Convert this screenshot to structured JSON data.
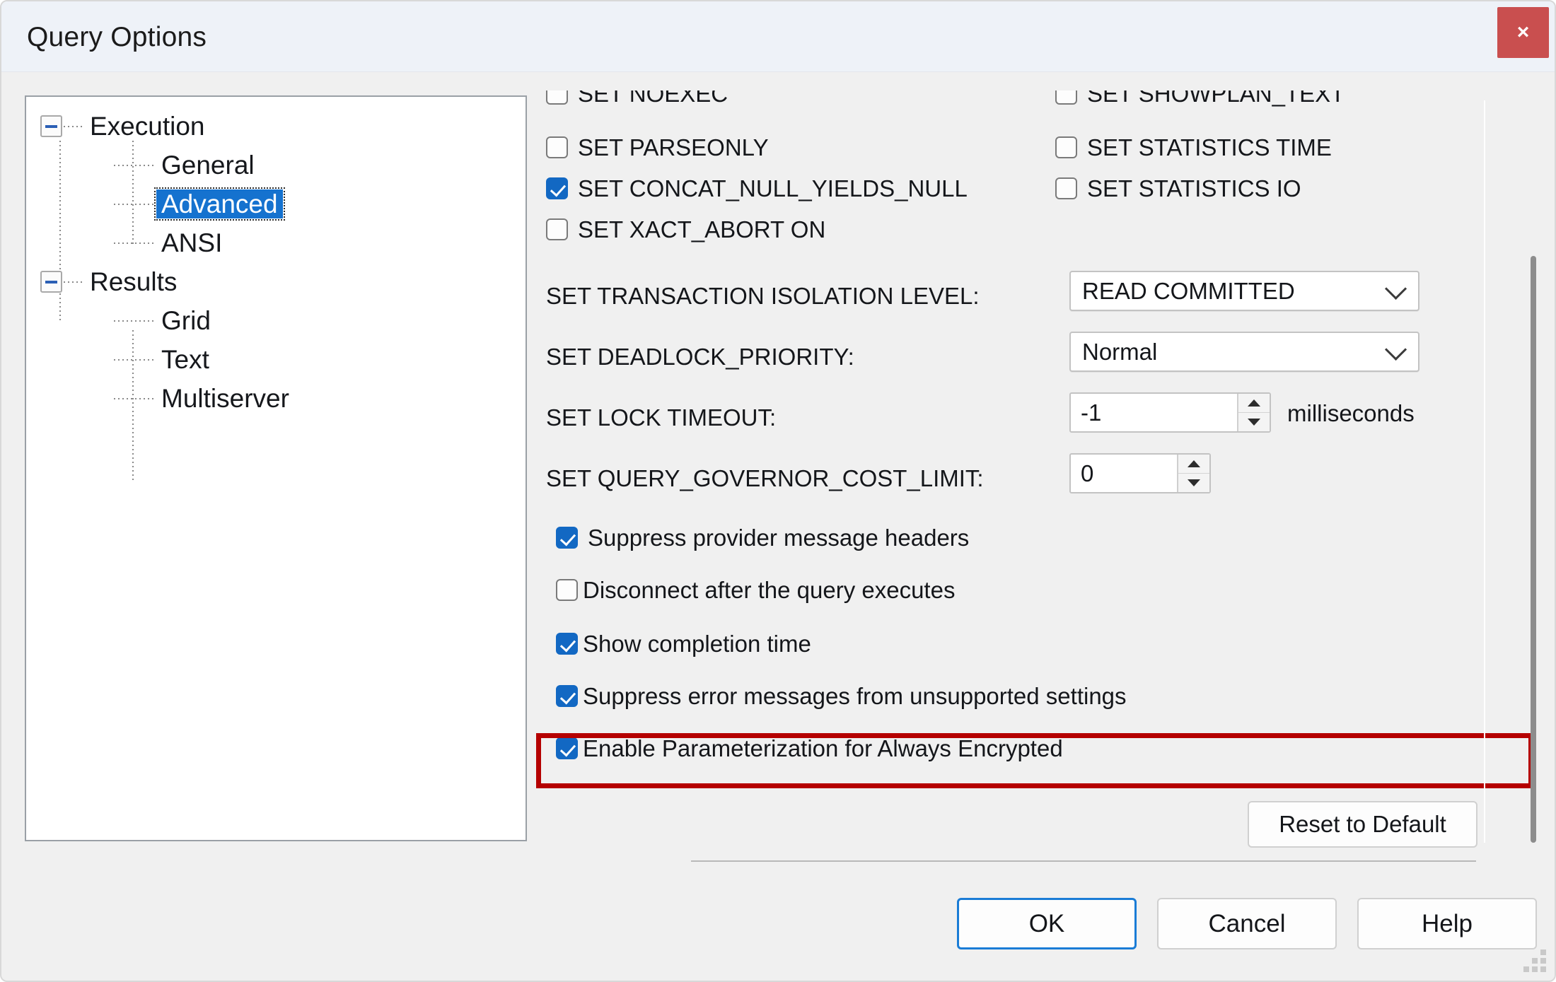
{
  "window": {
    "title": "Query Options",
    "close_label": "×"
  },
  "tree": {
    "nodes": [
      {
        "label": "Execution",
        "level": 0,
        "expander": "minus",
        "selected": false
      },
      {
        "label": "General",
        "level": 1,
        "expander": "none",
        "selected": false
      },
      {
        "label": "Advanced",
        "level": 1,
        "expander": "none",
        "selected": true
      },
      {
        "label": "ANSI",
        "level": 1,
        "expander": "none",
        "selected": false
      },
      {
        "label": "Results",
        "level": 0,
        "expander": "minus",
        "selected": false
      },
      {
        "label": "Grid",
        "level": 1,
        "expander": "none",
        "selected": false
      },
      {
        "label": "Text",
        "level": 1,
        "expander": "none",
        "selected": false
      },
      {
        "label": "Multiserver",
        "level": 1,
        "expander": "none",
        "selected": false
      }
    ]
  },
  "options": {
    "clipped_left": "SET NOEXEC",
    "clipped_right": "SET SHOWPLAN_TEXT",
    "checkbox_left": [
      {
        "label": "SET PARSEONLY",
        "checked": false,
        "mnemonic": "P"
      },
      {
        "label": "SET CONCAT_NULL_YIELDS_NULL",
        "checked": true,
        "mnemonic": "C"
      },
      {
        "label": "SET XACT_ABORT ON",
        "checked": false,
        "mnemonic": "X"
      }
    ],
    "checkbox_right": [
      {
        "label": "SET STATISTICS TIME",
        "checked": false,
        "mnemonic": "E"
      },
      {
        "label": "SET STATISTICS IO",
        "checked": false,
        "mnemonic": "A"
      }
    ],
    "isolation_level": {
      "label": "SET TRANSACTION ISOLATION LEVEL:",
      "value": "READ COMMITTED",
      "mnemonic": "T"
    },
    "deadlock_priority": {
      "label": "SET DEADLOCK_PRIORITY:",
      "value": "Normal",
      "mnemonic": "D"
    },
    "lock_timeout": {
      "label": "SET LOCK TIMEOUT:",
      "value": "-1",
      "unit": "milliseconds",
      "mnemonic": "L"
    },
    "query_governor": {
      "label": "SET QUERY_GOVERNOR_COST_LIMIT:",
      "value": "0",
      "mnemonic": "Q"
    },
    "checkbox_bottom": [
      {
        "label": "Suppress provider message headers",
        "checked": true,
        "mnemonic": "m",
        "highlighted": false
      },
      {
        "label": "Disconnect after the query executes",
        "checked": false,
        "mnemonic": "D",
        "highlighted": false
      },
      {
        "label": "Show completion time",
        "checked": true,
        "mnemonic": "h",
        "highlighted": false
      },
      {
        "label": "Suppress error messages from unsupported settings",
        "checked": true,
        "mnemonic": "u",
        "highlighted": false
      },
      {
        "label": "Enable Parameterization for Always Encrypted",
        "checked": true,
        "mnemonic": "z",
        "highlighted": true
      }
    ]
  },
  "buttons": {
    "reset": "Reset to Default",
    "ok": "OK",
    "cancel": "Cancel",
    "help": "Help"
  },
  "colors": {
    "accent_blue": "#1268c3",
    "selection_blue": "#1572cf",
    "annotation_red": "#b50000",
    "close_red": "#c94f4f",
    "dialog_bg": "#f0f0f0",
    "titlebar_bg": "#eef2f8"
  }
}
